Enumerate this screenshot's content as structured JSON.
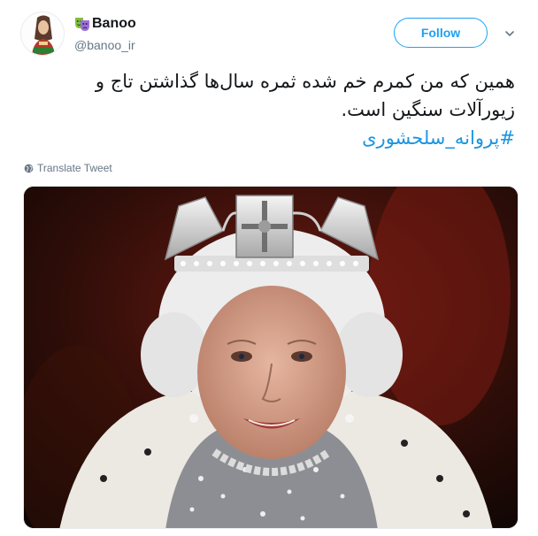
{
  "user": {
    "display_name": "Banoo",
    "handle": "@banoo_ir",
    "badge_icon": "theater-mask-icon",
    "avatar_icon": "woman-avatar-icon"
  },
  "follow": {
    "label": "Follow"
  },
  "menu": {
    "icon": "chevron-down-icon"
  },
  "tweet": {
    "line1": "همین که من کمرم خم شده ثمره سال‌ها گذاشتن تاج و",
    "line2": "زیورآلات سنگین است.",
    "hashtag": "#پروانه_سلحشوری"
  },
  "translate": {
    "label": "Translate Tweet",
    "icon": "globe-icon"
  },
  "colors": {
    "accent": "#1da1f2",
    "hashtag": "#1b95e0",
    "text": "#14171a",
    "muted": "#657786"
  }
}
